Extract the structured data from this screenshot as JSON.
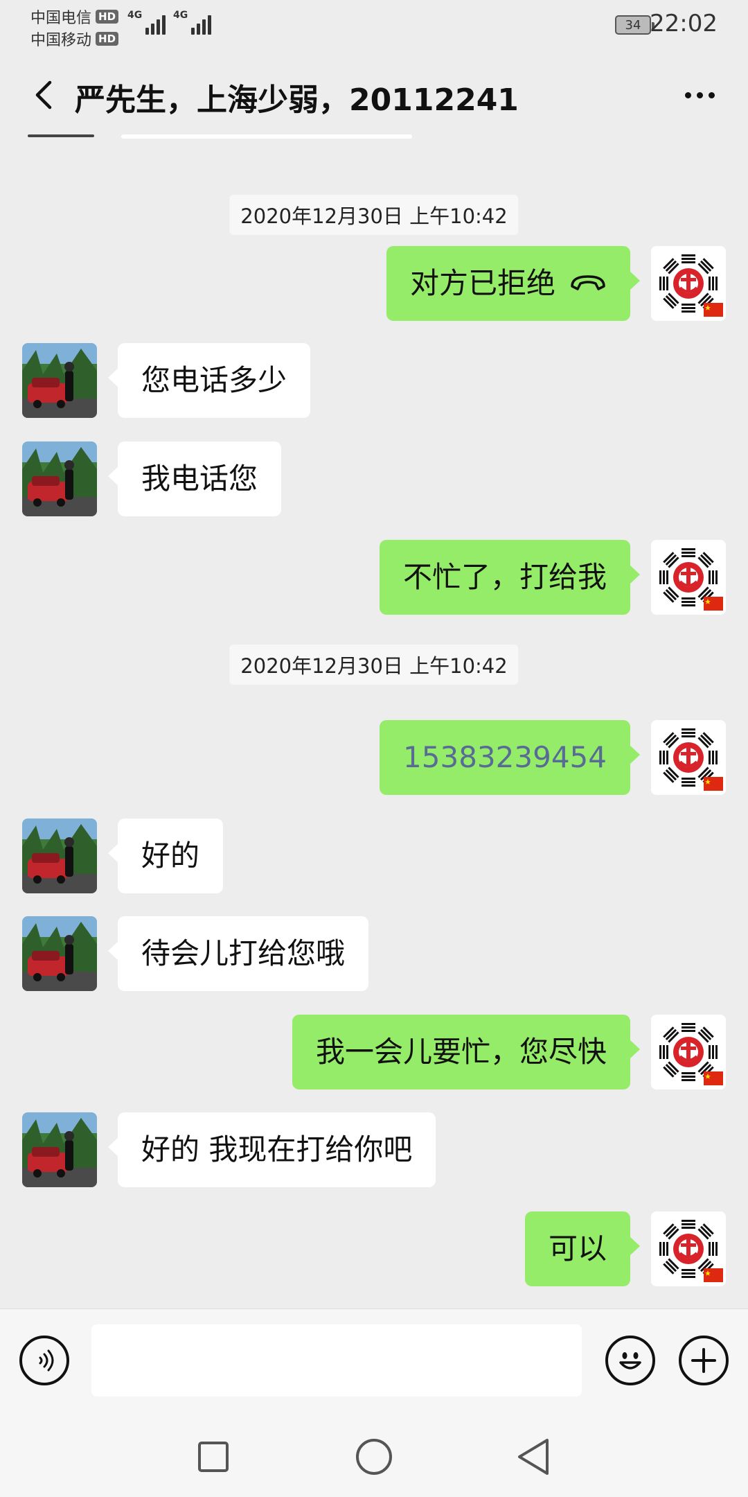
{
  "status_bar": {
    "carrier1": "中国电信",
    "carrier2": "中国移动",
    "hd_label": "HD",
    "network1": "4G",
    "network2": "4G",
    "battery": "34",
    "time": "22:02"
  },
  "header": {
    "title": "严先生，上海少弱，20112241",
    "back_icon": "chevron-left-icon",
    "more_icon": "more-dots-icon"
  },
  "colors": {
    "sent_bubble": "#95ec69",
    "received_bubble": "#ffffff",
    "background": "#ededed",
    "phone_number_link": "#576b95"
  },
  "messages": [
    {
      "type": "timestamp",
      "text": "2020年12月30日 上午10:42"
    },
    {
      "type": "sent",
      "text": "对方已拒绝",
      "icon": "phone-hangup-icon"
    },
    {
      "type": "received",
      "text": "您电话多少"
    },
    {
      "type": "received",
      "text": "我电话您"
    },
    {
      "type": "sent",
      "text": "不忙了，打给我"
    },
    {
      "type": "timestamp",
      "text": "2020年12月30日 上午10:42"
    },
    {
      "type": "sent",
      "text": "15383239454"
    },
    {
      "type": "received",
      "text": "好的"
    },
    {
      "type": "received",
      "text": "待会儿打给您哦"
    },
    {
      "type": "sent",
      "text": "我一会儿要忙，您尽快"
    },
    {
      "type": "received",
      "text": "好的 我现在打给你吧"
    },
    {
      "type": "sent",
      "text": "可以"
    }
  ],
  "input_bar": {
    "voice_icon": "voice-icon",
    "emoji_icon": "emoji-icon",
    "plus_icon": "plus-icon",
    "input_value": ""
  },
  "nav_bar": {
    "recent_icon": "square-icon",
    "home_icon": "circle-icon",
    "back_icon": "triangle-back-icon"
  }
}
